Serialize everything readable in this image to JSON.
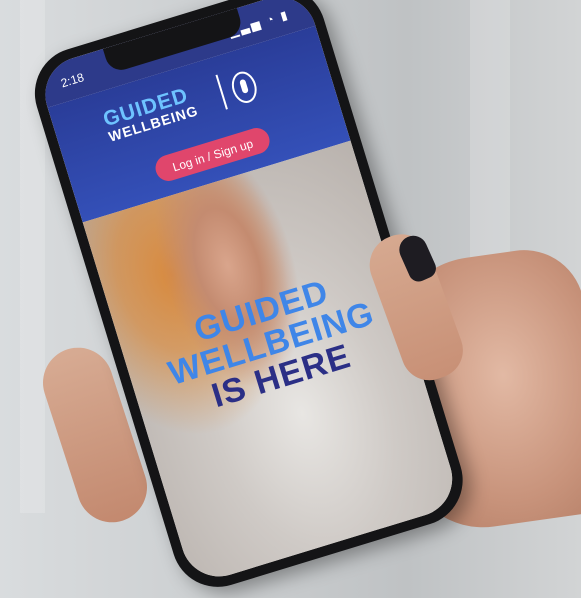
{
  "status_bar": {
    "time": "2:18",
    "icons": "▁▃▅ ◔ ▮"
  },
  "app": {
    "logo_line1": "GUIDED",
    "logo_line2": "WELLBEING",
    "login_label": "Log in / Sign up"
  },
  "hero": {
    "line1": "GUIDED",
    "line2": "WELLBEING",
    "line3": "IS HERE"
  },
  "colors": {
    "header_blue": "#2a3d99",
    "accent_pink": "#e0466c",
    "headline_light_blue": "#3f86e8",
    "headline_dark_blue": "#2b2f86"
  }
}
